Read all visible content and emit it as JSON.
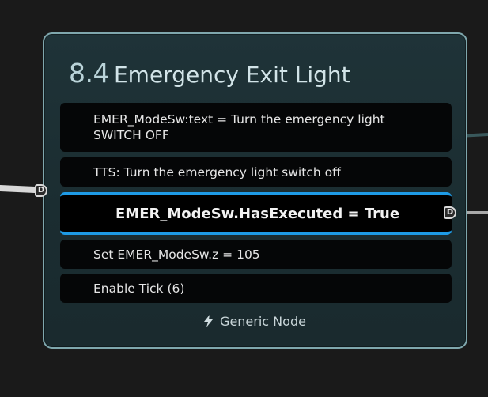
{
  "node": {
    "number": "8.4",
    "title": "Emergency Exit Light",
    "rows": [
      {
        "text": "EMER_ModeSw:text = Turn the emergency light SWITCH OFF"
      },
      {
        "text": "TTS: Turn the emergency light switch off"
      },
      {
        "text": "EMER_ModeSw.HasExecuted = True",
        "highlighted": true
      },
      {
        "text": "Set EMER_ModeSw.z = 105"
      },
      {
        "text": "Enable Tick (6)"
      }
    ],
    "footer_label": "Generic Node",
    "footer_icon": "lightning-bolt-icon",
    "input_pin_label": "D",
    "output_pin_label": "D"
  },
  "colors": {
    "node_border": "#7fa7ad",
    "highlight": "#1e9be6",
    "canvas": "#1a1a1a"
  }
}
